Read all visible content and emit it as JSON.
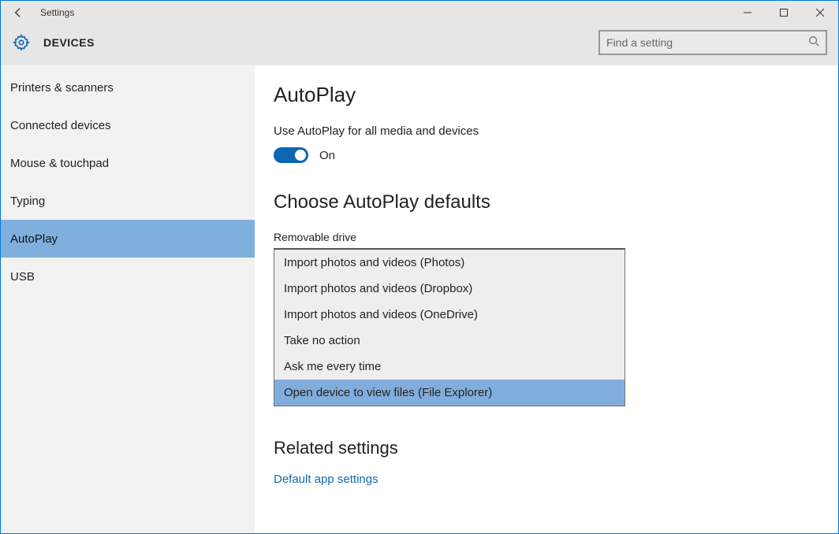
{
  "window": {
    "title": "Settings"
  },
  "header": {
    "section": "DEVICES",
    "search_placeholder": "Find a setting"
  },
  "sidebar": {
    "items": [
      {
        "label": "Printers & scanners",
        "active": false
      },
      {
        "label": "Connected devices",
        "active": false
      },
      {
        "label": "Mouse & touchpad",
        "active": false
      },
      {
        "label": "Typing",
        "active": false
      },
      {
        "label": "AutoPlay",
        "active": true
      },
      {
        "label": "USB",
        "active": false
      }
    ]
  },
  "main": {
    "title": "AutoPlay",
    "autoplay_all": {
      "label": "Use AutoPlay for all media and devices",
      "state_label": "On",
      "on": true
    },
    "defaults": {
      "heading": "Choose AutoPlay defaults",
      "removable_label": "Removable drive",
      "options": [
        "Import photos and videos (Photos)",
        "Import photos and videos (Dropbox)",
        "Import photos and videos (OneDrive)",
        "Take no action",
        "Ask me every time",
        "Open device to view files (File Explorer)"
      ],
      "selected_index": 5
    },
    "related": {
      "heading": "Related settings",
      "link": "Default app settings"
    }
  }
}
